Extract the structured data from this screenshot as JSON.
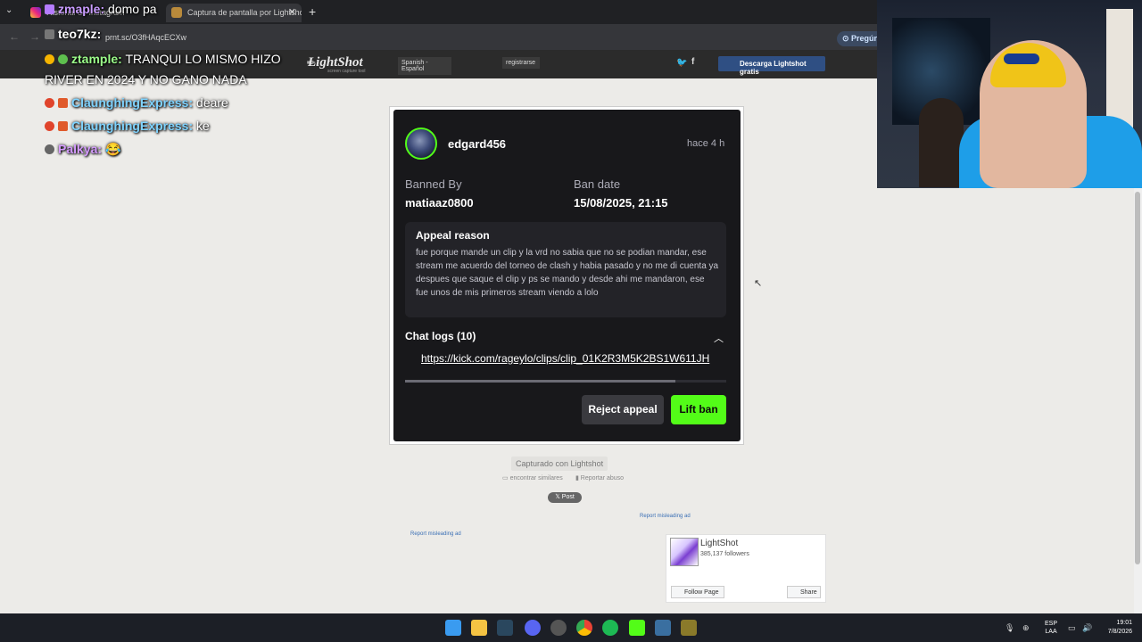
{
  "browser": {
    "tabs": [
      {
        "label": "Historial de Instagram"
      },
      {
        "label": "Captura de pantalla por Lightshot"
      }
    ],
    "new_tab": "+",
    "url": "prnt.sc/O3fHAqcECXw",
    "profile_button": "Pregún"
  },
  "lightshot_header": {
    "logo": "LightShot",
    "logo_sub": "screen capture tool",
    "language": "Spanish - Español",
    "register": "registrarse",
    "download": "Descarga Lightshot gratis"
  },
  "chat_overlay": [
    {
      "user": "zmaple",
      "message": "domo pa",
      "user_color": "#c99cff"
    },
    {
      "user": "teo7kz",
      "message": "",
      "user_color": "#ffffff"
    },
    {
      "user": "ztample",
      "message": "TRANQUI LO MISMO HIZO",
      "user_color": "#9cff8a"
    },
    {
      "user": "",
      "message": "RIVER EN 2024 Y NO GANO NADA",
      "user_color": "#ffffff"
    },
    {
      "user": "ClaunghingExpress",
      "message": "deare",
      "user_color": "#7fd3ff"
    },
    {
      "user": "ClaunghingExpress",
      "message": "ke",
      "user_color": "#7fd3ff"
    },
    {
      "user": "Palkya",
      "message": "",
      "user_color": "#d59bff"
    }
  ],
  "card": {
    "username": "edgard456",
    "time_ago": "hace 4 h",
    "banned_by_label": "Banned By",
    "banned_by": "matiaaz0800",
    "ban_date_label": "Ban date",
    "ban_date": "15/08/2025, 21:15",
    "appeal_title": "Appeal reason",
    "appeal_text": "fue porque mande un clip y la vrd no sabia que no se podian mandar, ese stream me acuerdo del torneo de clash y habia pasado y no me di cuenta ya despues que saque el clip y ps se mando y desde ahi me mandaron, ese fue unos de mis primeros stream viendo a lolo",
    "chat_logs_label": "Chat logs (10)",
    "chat_log_link": "https://kick.com/rageylo/clips/clip_01K2R3M5K2BS1W611JH",
    "reject_button": "Reject appeal",
    "lift_button": "Lift ban",
    "accent_color": "#53fc18"
  },
  "below_card": {
    "captured": "Capturado con Lightshot",
    "similar": "encontrar similares",
    "report": "Reportar abuso",
    "post": "𝕏 Post",
    "report_ad_1": "Report misleading ad",
    "report_ad_2": "Report misleading ad"
  },
  "fb_widget": {
    "name": "LightShot",
    "followers": "385,137 followers",
    "follow": "Follow Page",
    "share": "Share"
  },
  "taskbar": {
    "lang_top": "ESP",
    "lang_bottom": "LAA",
    "time": "19:01",
    "date": "7/8/2026"
  }
}
